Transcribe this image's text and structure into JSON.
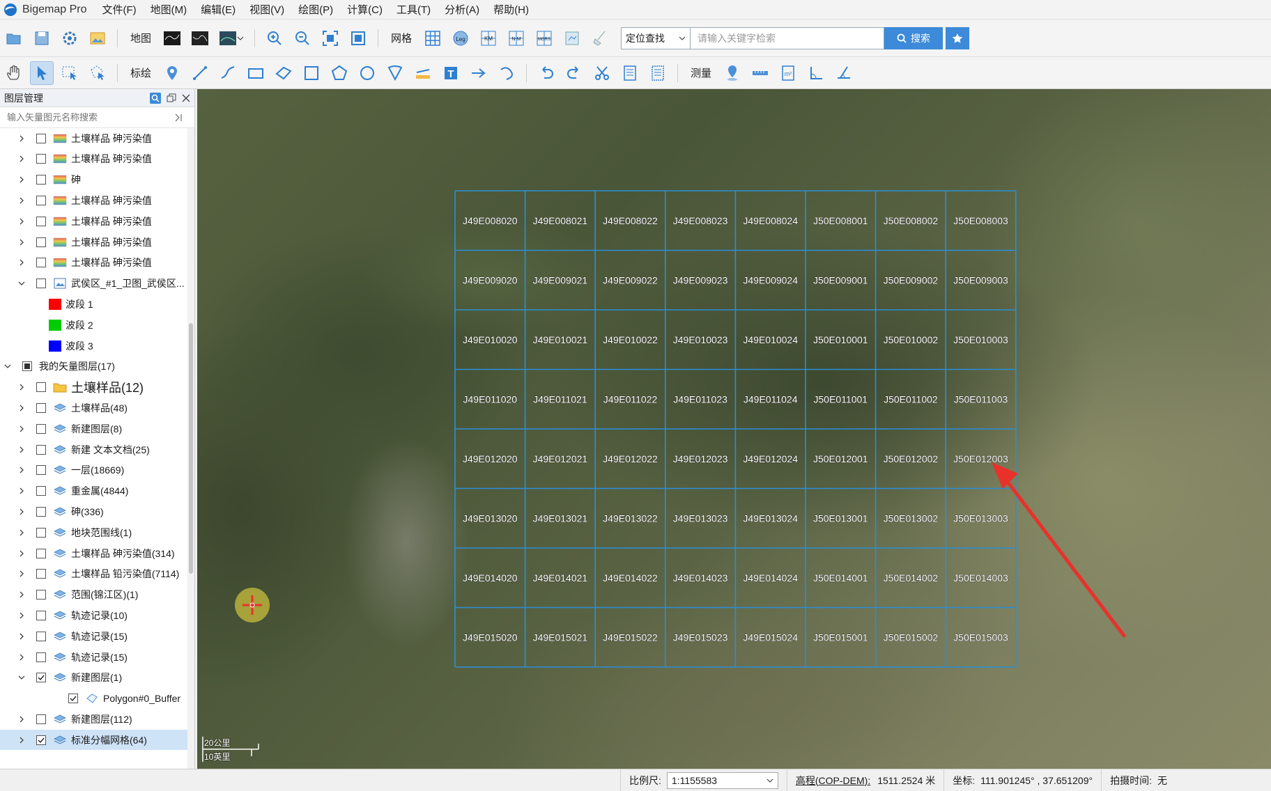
{
  "app": {
    "title": "Bigemap Pro",
    "menu": [
      "文件(F)",
      "地图(M)",
      "编辑(E)",
      "视图(V)",
      "绘图(P)",
      "计算(C)",
      "工具(T)",
      "分析(A)",
      "帮助(H)"
    ]
  },
  "toolbar1": {
    "map_label": "地图",
    "grid_label": "网格",
    "search_mode": "定位查找",
    "search_placeholder": "请输入关键字检索",
    "search_button": "搜索",
    "grid_badges": [
      "Leg",
      "KM",
      "N-M",
      "MGRS"
    ]
  },
  "toolbar2": {
    "draw_label": "标绘",
    "measure_label": "测量",
    "text_tool_glyph": "T"
  },
  "layer_panel": {
    "title": "图层管理",
    "search_placeholder": "输入矢量图元名称搜索",
    "rows": [
      {
        "label": "土壤样品 砷污染值",
        "level": 1,
        "icon": "gradient-layer-icon",
        "expand": "collapsed",
        "checked": false
      },
      {
        "label": "土壤样品 砷污染值",
        "level": 1,
        "icon": "gradient-layer-icon",
        "expand": "collapsed",
        "checked": false
      },
      {
        "label": "砷",
        "level": 1,
        "icon": "gradient-layer-icon",
        "expand": "collapsed",
        "checked": false
      },
      {
        "label": "土壤样品 砷污染值",
        "level": 1,
        "icon": "gradient-layer-icon",
        "expand": "collapsed",
        "checked": false
      },
      {
        "label": "土壤样品 砷污染值",
        "level": 1,
        "icon": "gradient-layer-icon",
        "expand": "collapsed",
        "checked": false
      },
      {
        "label": "土壤样品 砷污染值",
        "level": 1,
        "icon": "gradient-layer-icon",
        "expand": "collapsed",
        "checked": false
      },
      {
        "label": "土壤样品 砷污染值",
        "level": 1,
        "icon": "gradient-layer-icon",
        "expand": "collapsed",
        "checked": false
      },
      {
        "label": "武侯区_#1_卫图_武侯区...",
        "level": 1,
        "icon": "raster-image-icon",
        "expand": "expanded",
        "checked": false
      },
      {
        "label": "波段 1",
        "level": 2,
        "swatch": "#ff0000"
      },
      {
        "label": "波段 2",
        "level": 2,
        "swatch": "#00cc00"
      },
      {
        "label": "波段 3",
        "level": 2,
        "swatch": "#0000ff"
      },
      {
        "label": "我的矢量图层(17)",
        "level": 0,
        "icon": "",
        "expand": "expanded",
        "checked": "partial"
      },
      {
        "label": "土壤样品(12)",
        "level": 1,
        "icon": "folder-icon",
        "expand": "collapsed",
        "checked": false,
        "large": true
      },
      {
        "label": "土壤样品(48)",
        "level": 1,
        "icon": "vector-layer-icon",
        "expand": "collapsed",
        "checked": false
      },
      {
        "label": "新建图层(8)",
        "level": 1,
        "icon": "vector-layer-icon",
        "expand": "collapsed",
        "checked": false
      },
      {
        "label": "新建 文本文档(25)",
        "level": 1,
        "icon": "vector-layer-icon",
        "expand": "collapsed",
        "checked": false
      },
      {
        "label": "一层(18669)",
        "level": 1,
        "icon": "vector-layer-icon",
        "expand": "collapsed",
        "checked": false
      },
      {
        "label": "重金属(4844)",
        "level": 1,
        "icon": "vector-layer-icon",
        "expand": "collapsed",
        "checked": false
      },
      {
        "label": "砷(336)",
        "level": 1,
        "icon": "vector-layer-icon",
        "expand": "collapsed",
        "checked": false
      },
      {
        "label": "地块范围线(1)",
        "level": 1,
        "icon": "vector-layer-icon",
        "expand": "collapsed",
        "checked": false
      },
      {
        "label": "土壤样品 砷污染值(314)",
        "level": 1,
        "icon": "vector-layer-icon",
        "expand": "collapsed",
        "checked": false
      },
      {
        "label": "土壤样品 铅污染值(7114)",
        "level": 1,
        "icon": "vector-layer-icon",
        "expand": "collapsed",
        "checked": false
      },
      {
        "label": "范围(锦江区)(1)",
        "level": 1,
        "icon": "vector-layer-icon",
        "expand": "collapsed",
        "checked": false
      },
      {
        "label": "轨迹记录(10)",
        "level": 1,
        "icon": "vector-layer-icon",
        "expand": "collapsed",
        "checked": false
      },
      {
        "label": "轨迹记录(15)",
        "level": 1,
        "icon": "vector-layer-icon",
        "expand": "collapsed",
        "checked": false
      },
      {
        "label": "轨迹记录(15)",
        "level": 1,
        "icon": "vector-layer-icon",
        "expand": "collapsed",
        "checked": false
      },
      {
        "label": "新建图层(1)",
        "level": 1,
        "icon": "vector-layer-icon",
        "expand": "expanded",
        "checked": true
      },
      {
        "label": "Polygon#0_Buffer",
        "level": 2,
        "icon": "polygon-icon",
        "expand": "none",
        "checked": true
      },
      {
        "label": "新建图层(112)",
        "level": 1,
        "icon": "vector-layer-icon",
        "expand": "collapsed",
        "checked": false
      },
      {
        "label": "标准分幅网格(64)",
        "level": 1,
        "icon": "vector-layer-icon",
        "expand": "collapsed",
        "checked": true,
        "selected": true
      }
    ]
  },
  "map": {
    "grid_cells": [
      [
        "J49E008020",
        "J49E008021",
        "J49E008022",
        "J49E008023",
        "J49E008024",
        "J50E008001",
        "J50E008002",
        "J50E008003"
      ],
      [
        "J49E009020",
        "J49E009021",
        "J49E009022",
        "J49E009023",
        "J49E009024",
        "J50E009001",
        "J50E009002",
        "J50E009003"
      ],
      [
        "J49E010020",
        "J49E010021",
        "J49E010022",
        "J49E010023",
        "J49E010024",
        "J50E010001",
        "J50E010002",
        "J50E010003"
      ],
      [
        "J49E011020",
        "J49E011021",
        "J49E011022",
        "J49E011023",
        "J49E011024",
        "J50E011001",
        "J50E011002",
        "J50E011003"
      ],
      [
        "J49E012020",
        "J49E012021",
        "J49E012022",
        "J49E012023",
        "J49E012024",
        "J50E012001",
        "J50E012002",
        "J50E012003"
      ],
      [
        "J49E013020",
        "J49E013021",
        "J49E013022",
        "J49E013023",
        "J49E013024",
        "J50E013001",
        "J50E013002",
        "J50E013003"
      ],
      [
        "J49E014020",
        "J49E014021",
        "J49E014022",
        "J49E014023",
        "J49E014024",
        "J50E014001",
        "J50E014002",
        "J50E014003"
      ],
      [
        "J49E015020",
        "J49E015021",
        "J49E015022",
        "J49E015023",
        "J49E015024",
        "J50E015001",
        "J50E015002",
        "J50E015003"
      ]
    ],
    "grid_color": "#2a8fd6",
    "annotation_color": "#e8312b",
    "scale_km": "20公里",
    "scale_mi": "10英里"
  },
  "status": {
    "scale_label": "比例尺:",
    "scale_value": "1:1155583",
    "elevation_label": "高程(COP-DEM):",
    "elevation_value": "1511.2524 米",
    "coord_label": "坐标:",
    "coord_value": "111.901245° , 37.651209°",
    "capture_label": "拍摄时间:",
    "capture_value": "无"
  }
}
